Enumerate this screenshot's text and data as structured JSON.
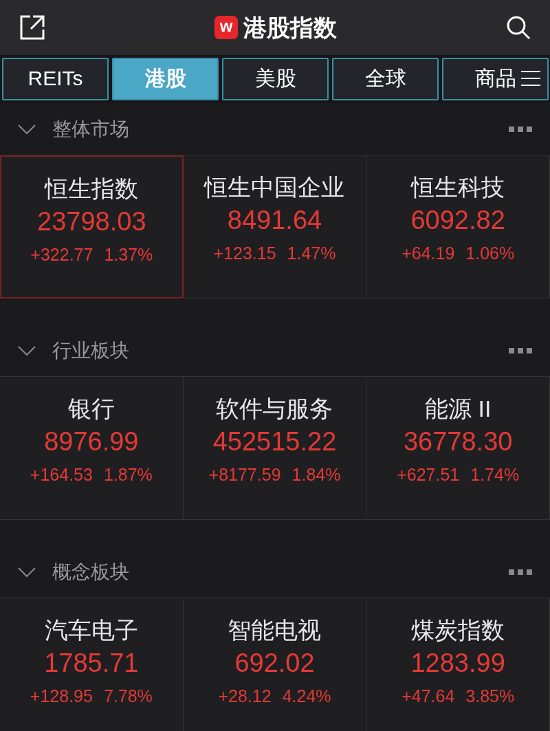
{
  "header": {
    "title": "港股指数",
    "logo_letter": "w"
  },
  "tabs": [
    {
      "label": "REITs",
      "selected": false
    },
    {
      "label": "港股",
      "selected": true
    },
    {
      "label": "美股",
      "selected": false
    },
    {
      "label": "全球",
      "selected": false
    },
    {
      "label": "商品",
      "selected": false
    }
  ],
  "sections": [
    {
      "title": "整体市场",
      "expanded": true,
      "items": [
        {
          "name": "恒生指数",
          "value": "23798.03",
          "change": "+322.77",
          "percent": "1.37%",
          "selected": true
        },
        {
          "name": "恒生中国企业",
          "value": "8491.64",
          "change": "+123.15",
          "percent": "1.47%",
          "selected": false
        },
        {
          "name": "恒生科技",
          "value": "6092.82",
          "change": "+64.19",
          "percent": "1.06%",
          "selected": false
        }
      ]
    },
    {
      "title": "行业板块",
      "expanded": true,
      "items": [
        {
          "name": "银行",
          "value": "8976.99",
          "change": "+164.53",
          "percent": "1.87%",
          "selected": false
        },
        {
          "name": "软件与服务",
          "value": "452515.22",
          "change": "+8177.59",
          "percent": "1.84%",
          "selected": false
        },
        {
          "name": "能源 II",
          "value": "36778.30",
          "change": "+627.51",
          "percent": "1.74%",
          "selected": false
        }
      ]
    },
    {
      "title": "概念板块",
      "expanded": true,
      "items": [
        {
          "name": "汽车电子",
          "value": "1785.71",
          "change": "+128.95",
          "percent": "7.78%",
          "selected": false
        },
        {
          "name": "智能电视",
          "value": "692.02",
          "change": "+28.12",
          "percent": "4.24%",
          "selected": false
        },
        {
          "name": "煤炭指数",
          "value": "1283.99",
          "change": "+47.64",
          "percent": "3.85%",
          "selected": false
        }
      ]
    }
  ]
}
